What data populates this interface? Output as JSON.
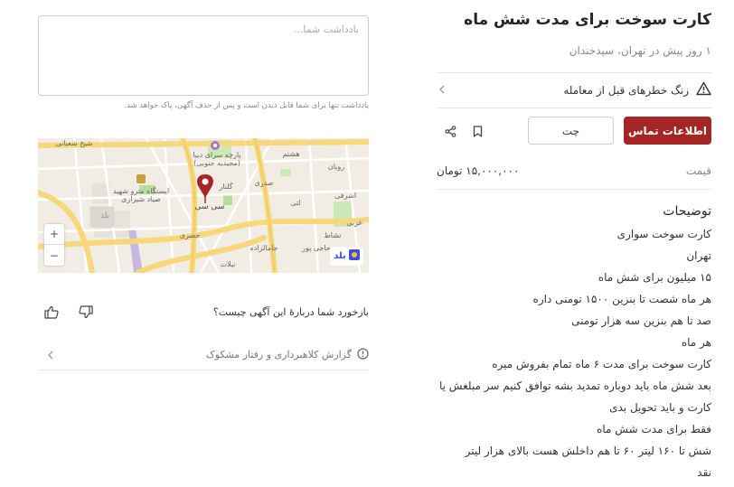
{
  "ad": {
    "title": "کارت سوخت برای مدت شش ماه",
    "subtitle": "۱ روز پیش در تهران، سیدخندان"
  },
  "warning": {
    "label": "زنگ خطرهای قبل از معامله",
    "icon": "warning-triangle-icon"
  },
  "actions": {
    "contact_label": "اطلاعات تماس",
    "chat_label": "چت",
    "contact_color": "#a62626"
  },
  "price": {
    "label": "قیمت",
    "value": "۱۵,۰۰۰,۰۰۰ تومان"
  },
  "description": {
    "title": "توضیحات",
    "lines": [
      "کارت سوخت سواری",
      "تهران",
      "۱۵ میلیون برای شش ماه",
      "هر ماه شصت تا بنزین ۱۵۰۰ تومنی داره",
      "صد تا هم بنزین سه هزار تومنی",
      "هر ماه",
      "کارت سوخت برای مدت ۶ ماه تمام بفروش میره",
      "بعد شش ماه باید دوباره تمدید بشه توافق کنیم سر مبلغش یا",
      "کارت و باید تحویل بدی",
      "فقط برای مدت شش ماه",
      "شش تا ۱۶۰ لیتر ۶۰ تا هم داخلش هست بالای هزار لیتر",
      "نقد"
    ]
  },
  "note": {
    "placeholder": "یادداشت شما...",
    "hint": "یادداشت تنها برای شما قابل دیدن است و پس از حذف آگهی، پاک خواهد شد."
  },
  "map": {
    "labels": {
      "park": "پارچه سرای دیبا",
      "park_sub": "(مجیدیه جنوبی)",
      "station": "ایستگاه مترو شهید",
      "station_sub": "صیاد شیرازی",
      "sheikh": "شیخ شعبانی",
      "rouyan": "رویان",
      "sisi": "سی سی",
      "hasht": "هشتم",
      "sadri": "صدری",
      "lati": "لتی",
      "jamalzadeh": "جامالزاده",
      "hosri": "حصری",
      "hajipour": "حاجی پور",
      "eshraqi": "اشرفی",
      "golnar": "گلنار",
      "nelat": "نیلات",
      "neshat": "نشاط",
      "gharbi": "غربی",
      "baad": "بلد"
    },
    "zoom_in": "+",
    "zoom_out": "−",
    "badge": "بلد"
  },
  "feedback": {
    "question": "بازخورد شما دربارهٔ این آگهی چیست؟"
  },
  "report": {
    "label": "گزارش کلاهبرداری و رفتار مشکوک"
  }
}
